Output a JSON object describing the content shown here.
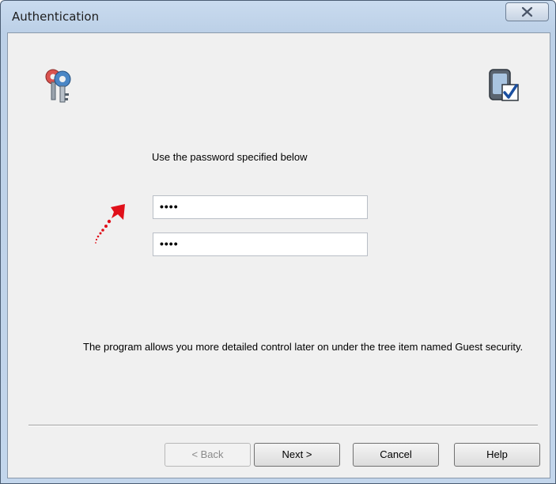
{
  "window": {
    "title": "Authentication"
  },
  "icons": {
    "top_left": "keys-icon",
    "top_right": "device-check-icon",
    "arrow": "red-arrow-icon",
    "close": "close-icon"
  },
  "main": {
    "prompt": "Use the password specified below",
    "password": "••••",
    "confirm_password": "••••",
    "info": "The program allows you more detailed control later on under the tree item named Guest security."
  },
  "buttons": {
    "back": "< Back",
    "next": "Next >",
    "cancel": "Cancel",
    "help": "Help"
  },
  "colors": {
    "accent_red": "#e0101a"
  }
}
